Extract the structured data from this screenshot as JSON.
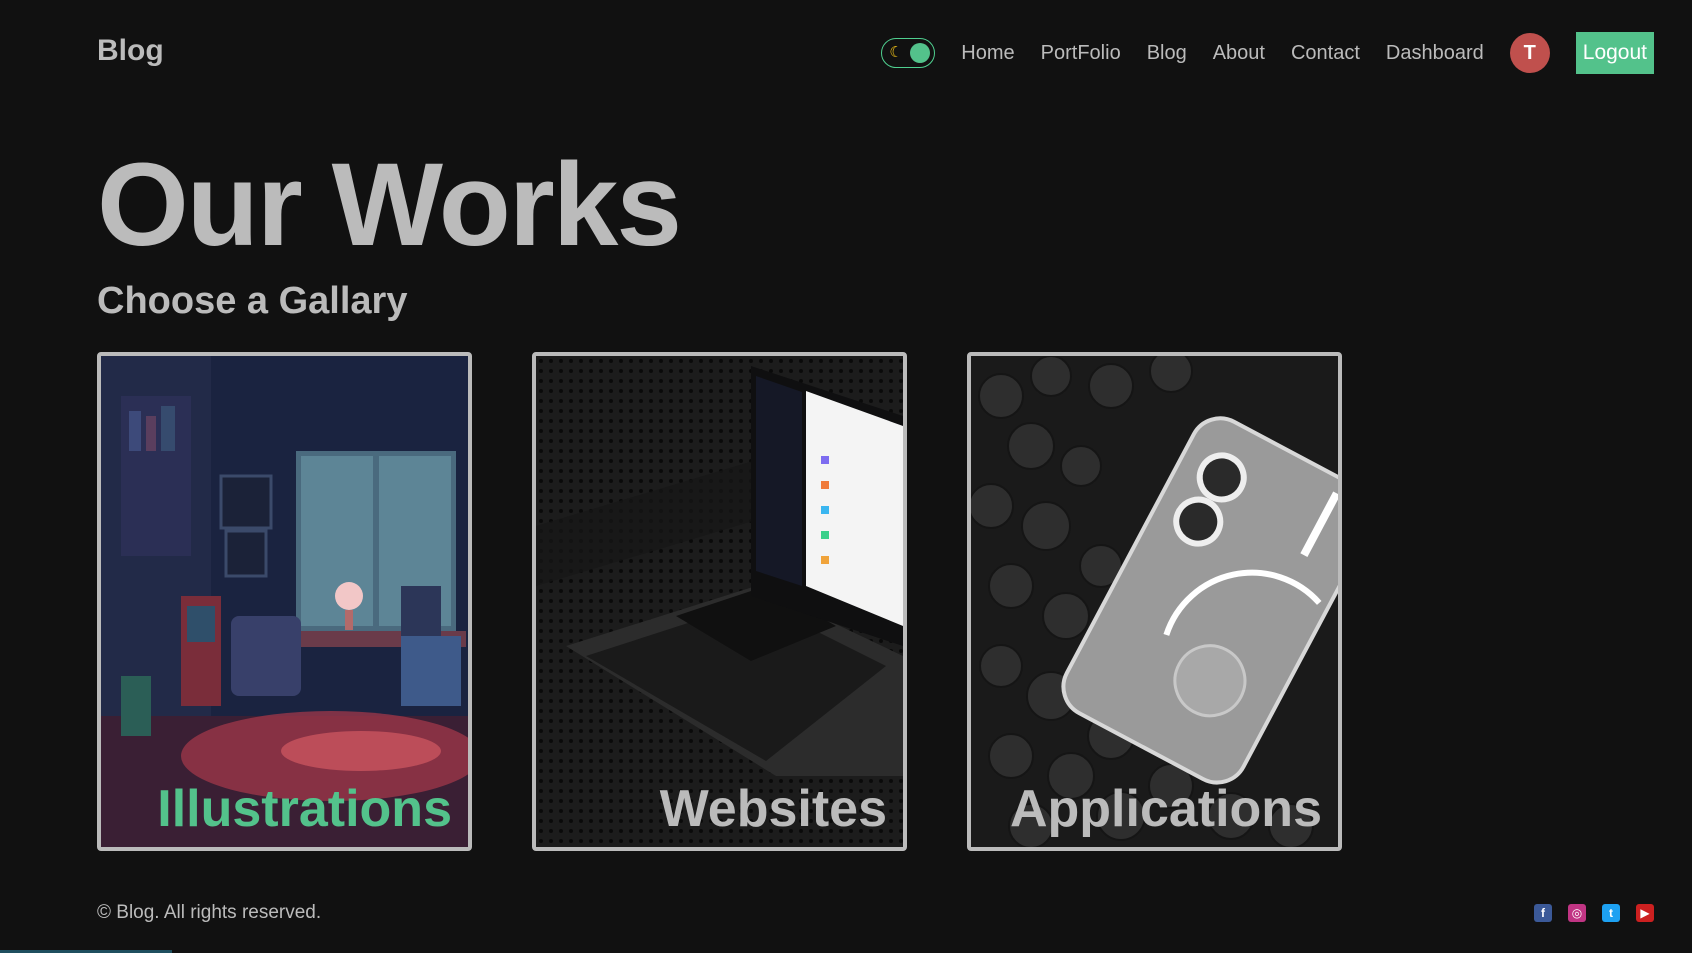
{
  "nav": {
    "logo": "Blog",
    "links": [
      "Home",
      "PortFolio",
      "Blog",
      "About",
      "Contact",
      "Dashboard"
    ],
    "avatar_initial": "T",
    "logout_label": "Logout",
    "theme_toggle_icon": "moon-icon"
  },
  "hero": {
    "title": "Our Works",
    "subtitle": "Choose a Gallary"
  },
  "cards": [
    {
      "label": "Illustrations",
      "label_color": "#53c28b",
      "image": "pixel-art-room-illustration"
    },
    {
      "label": "Websites",
      "label_color": "#bbbbbb",
      "image": "laptop-website-photo"
    },
    {
      "label": "Applications",
      "label_color": "#bbbbbb",
      "image": "phone-on-foam-photo"
    }
  ],
  "footer": {
    "copyright": "© Blog. All rights reserved.",
    "socials": [
      "facebook-icon",
      "instagram-icon",
      "twitter-icon",
      "youtube-icon"
    ]
  },
  "colors": {
    "background": "#111111",
    "accent": "#53c28b",
    "text": "#bbbbbb",
    "avatar": "#c0504d"
  }
}
